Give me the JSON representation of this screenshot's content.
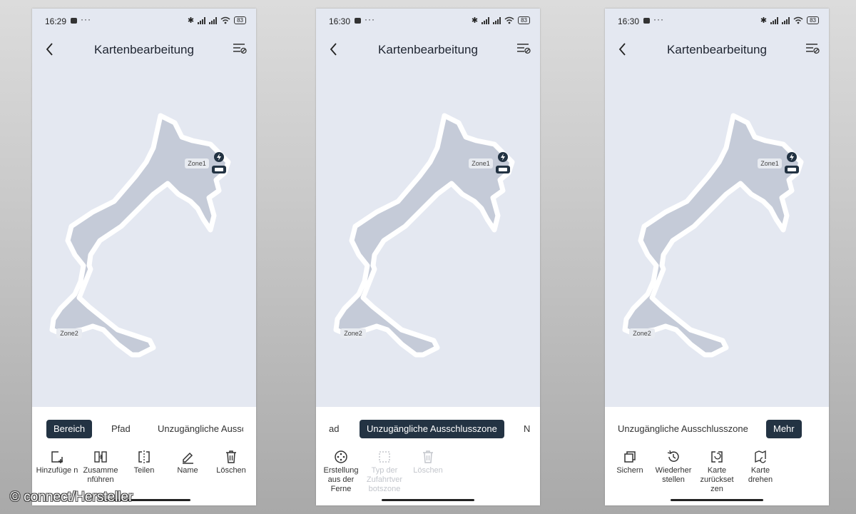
{
  "watermark": "© connect/Hersteller",
  "title": "Kartenbearbeitung",
  "zones": {
    "zone1": "Zone1",
    "zone2": "Zone2"
  },
  "colors": {
    "map_bg": "#e4e8f1",
    "map_fill": "#c5cbd8",
    "map_border": "#ffffff",
    "tab_active": "#233343"
  },
  "screens": [
    {
      "time": "16:29",
      "battery": "83",
      "tabs": [
        {
          "label": "Bereich",
          "active": true
        },
        {
          "label": "Pfad",
          "active": false
        },
        {
          "label": "Unzugängliche Ausscl",
          "active": false
        }
      ],
      "actions": [
        {
          "label": "Hinzufüge n",
          "icon": "add-square-icon"
        },
        {
          "label": "Zusamme nführen",
          "icon": "merge-icon"
        },
        {
          "label": "Teilen",
          "icon": "split-icon"
        },
        {
          "label": "Name",
          "icon": "pencil-icon"
        },
        {
          "label": "Löschen",
          "icon": "trash-icon"
        }
      ]
    },
    {
      "time": "16:30",
      "battery": "83",
      "tabs": [
        {
          "label": "ad",
          "active": false
        },
        {
          "label": "Unzugängliche Ausschlusszone",
          "active": true
        },
        {
          "label": "N",
          "active": false
        }
      ],
      "actions": [
        {
          "label": "Erstellung aus der Ferne",
          "icon": "remote-create-icon",
          "enabled": true
        },
        {
          "label": "Typ der Zufahrtver botszone",
          "icon": "dashed-square-icon",
          "enabled": false
        },
        {
          "label": "Löschen",
          "icon": "trash-icon",
          "enabled": false
        }
      ]
    },
    {
      "time": "16:30",
      "battery": "83",
      "tabs": [
        {
          "label": "Unzugängliche Ausschlusszone",
          "active": false
        },
        {
          "label": "Mehr",
          "active": true
        }
      ],
      "actions": [
        {
          "label": "Sichern",
          "icon": "copy-icon"
        },
        {
          "label": "Wiederher stellen",
          "icon": "history-icon"
        },
        {
          "label": "Karte zurückset zen",
          "icon": "map-reset-icon"
        },
        {
          "label": "Karte drehen",
          "icon": "map-rotate-icon"
        }
      ]
    }
  ]
}
